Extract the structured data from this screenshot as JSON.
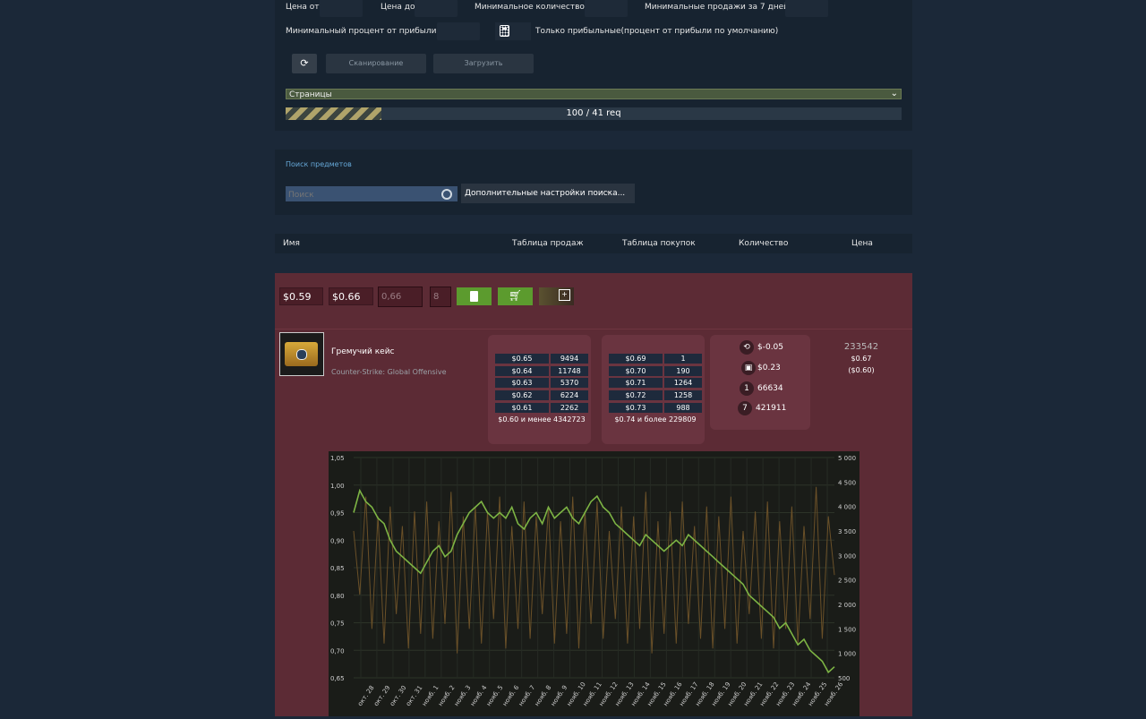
{
  "filters": {
    "price_from_label": "Цена от",
    "price_to_label": "Цена до",
    "min_qty_label": "Минимальное количество",
    "min_sales_label": "Минимальные продажи за 7 дней",
    "min_profit_label": "Минимальный процент от прибыли",
    "profitable_only_label": "Только прибыльные(процент от прибыли по умолчанию)",
    "scan_label": "Сканирование",
    "load_label": "Загрузить",
    "pages_label": "Страницы",
    "progress_text": "100 / 41 req",
    "progress_fraction": 0.155
  },
  "search": {
    "title": "Поиск предметов",
    "placeholder": "Поиск",
    "advanced_label": "Дополнительные настройки поиска..."
  },
  "table_header": {
    "name": "Имя",
    "sales": "Таблица продаж",
    "buys": "Таблица покупок",
    "qty": "Количество",
    "price": "Цена"
  },
  "item": {
    "buy_price": "$0.59",
    "sell_price": "$0.66",
    "input_value": "0,66",
    "qty_value": "8",
    "name": "Гремучий кейс",
    "game": "Counter-Strike: Global Offensive",
    "sell_orders": [
      {
        "price": "$0.65",
        "qty": "9494"
      },
      {
        "price": "$0.64",
        "qty": "11748"
      },
      {
        "price": "$0.63",
        "qty": "5370"
      },
      {
        "price": "$0.62",
        "qty": "6224"
      },
      {
        "price": "$0.61",
        "qty": "2262"
      }
    ],
    "sell_total": "$0.60 и менее 4342723",
    "buy_orders": [
      {
        "price": "$0.69",
        "qty": "1"
      },
      {
        "price": "$0.70",
        "qty": "190"
      },
      {
        "price": "$0.71",
        "qty": "1264"
      },
      {
        "price": "$0.72",
        "qty": "1258"
      },
      {
        "price": "$0.73",
        "qty": "988"
      }
    ],
    "buy_total": "$0.74 и более 229809",
    "stats": {
      "profit": "$-0.05",
      "fee": "$0.23",
      "volume_day": "66634",
      "volume_week": "421911"
    },
    "count": "233542",
    "price_now": "$0.67",
    "price_net": "($0.60)"
  },
  "chart_data": {
    "type": "line",
    "y_left_ticks": [
      "1,05",
      "1,00",
      "0,95",
      "0,90",
      "0,85",
      "0,80",
      "0,75",
      "0,70",
      "0,65"
    ],
    "y_right_ticks": [
      "5 000",
      "4 500",
      "4 000",
      "3 500",
      "3 000",
      "2 500",
      "2 000",
      "1 500",
      "1 000",
      "500"
    ],
    "x_ticks": [
      "окт. 28",
      "окт. 29",
      "окт. 30",
      "окт. 31",
      "нояб. 1",
      "нояб. 2",
      "нояб. 3",
      "нояб. 4",
      "нояб. 5",
      "нояб. 6",
      "нояб. 7",
      "нояб. 8",
      "нояб. 9",
      "нояб. 10",
      "нояб. 11",
      "нояб. 12",
      "нояб. 13",
      "нояб. 14",
      "нояб. 15",
      "нояб. 16",
      "нояб. 17",
      "нояб. 18",
      "нояб. 19",
      "нояб. 20",
      "нояб. 21",
      "нояб. 22",
      "нояб. 23",
      "нояб. 24",
      "нояб. 25",
      "нояб. 26"
    ],
    "ylim_left": [
      0.65,
      1.05
    ],
    "ylim_right": [
      500,
      5000
    ],
    "series": [
      {
        "axis": "left",
        "color": "#7db444",
        "values": [
          0.95,
          0.99,
          0.97,
          0.96,
          0.94,
          0.93,
          0.9,
          0.88,
          0.87,
          0.86,
          0.85,
          0.84,
          0.86,
          0.88,
          0.89,
          0.87,
          0.88,
          0.91,
          0.93,
          0.95,
          0.96,
          0.97,
          0.95,
          0.94,
          0.95,
          0.94,
          0.96,
          0.93,
          0.92,
          0.94,
          0.95,
          0.93,
          0.96,
          0.94,
          0.95,
          0.96,
          0.94,
          0.93,
          0.95,
          0.97,
          0.98,
          0.96,
          0.95,
          0.93,
          0.92,
          0.91,
          0.9,
          0.89,
          0.91,
          0.9,
          0.89,
          0.88,
          0.89,
          0.9,
          0.89,
          0.91,
          0.9,
          0.89,
          0.88,
          0.87,
          0.86,
          0.85,
          0.84,
          0.83,
          0.82,
          0.8,
          0.79,
          0.78,
          0.77,
          0.76,
          0.74,
          0.75,
          0.73,
          0.71,
          0.72,
          0.7,
          0.69,
          0.68,
          0.66,
          0.67
        ]
      },
      {
        "axis": "right",
        "color": "#6a5028",
        "values": [
          3500,
          2200,
          4200,
          1500,
          3800,
          1200,
          4000,
          1800,
          3600,
          1100,
          3900,
          1400,
          4100,
          1300,
          3700,
          1600,
          4300,
          1000,
          3800,
          1500,
          4000,
          1200,
          3900,
          1700,
          4200,
          1100,
          3600,
          1500,
          4100,
          1300,
          3800,
          1800,
          4000,
          1200,
          3700,
          1400,
          4200,
          1100,
          3900,
          1600,
          4100,
          1300,
          3500,
          1700,
          4000,
          1200,
          3800,
          1500,
          4300,
          1000,
          3700,
          1400,
          3900,
          1200,
          4100,
          1600,
          3600,
          1300,
          4000,
          1100,
          3800,
          1500,
          4200,
          1200,
          3500,
          1800,
          3900,
          1300,
          4100,
          1100,
          3700,
          1500,
          4000,
          1200,
          3600,
          1700,
          4400,
          1300,
          3800,
          2600
        ]
      }
    ]
  }
}
